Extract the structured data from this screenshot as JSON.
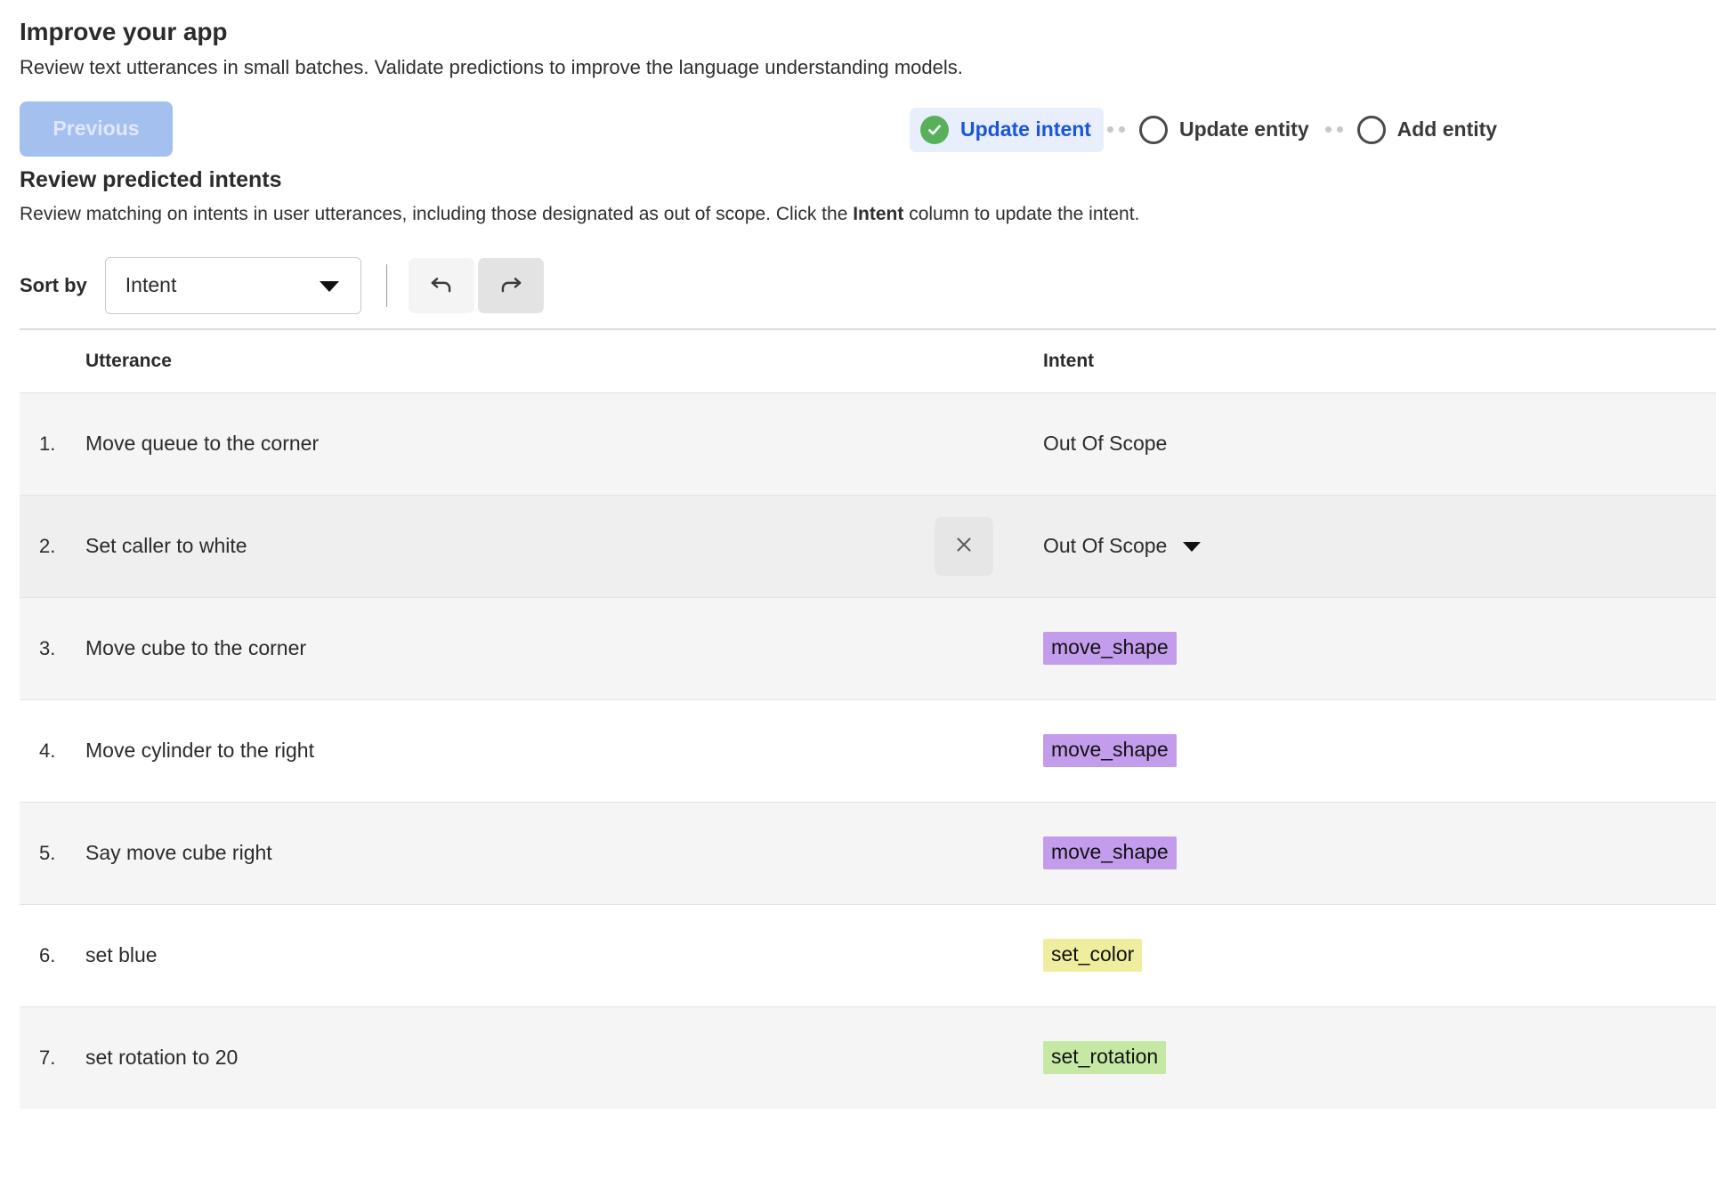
{
  "header": {
    "title": "Improve your app",
    "subtitle": "Review text utterances in small batches. Validate predictions to improve the language understanding models."
  },
  "nav": {
    "previous_label": "Previous"
  },
  "stepper": {
    "active_color": "#1a56d6",
    "active_pill_bg": "#e8eefc",
    "complete_color": "#58b15a",
    "steps": [
      {
        "label": "Update intent",
        "state": "complete",
        "icon": "check-circle-icon"
      },
      {
        "label": "Update entity",
        "state": "pending",
        "icon": "empty-circle-icon"
      },
      {
        "label": "Add entity",
        "state": "pending",
        "icon": "empty-circle-icon"
      }
    ]
  },
  "section": {
    "title": "Review predicted intents",
    "desc_before": "Review matching on intents in user utterances, including those designated as out of scope. Click the ",
    "desc_bold": "Intent",
    "desc_after": " column to update the intent."
  },
  "toolbar": {
    "sort_label": "Sort by",
    "sort_value": "Intent",
    "sort_options": [
      "Intent"
    ],
    "undo_icon": "undo-icon",
    "redo_icon": "redo-icon"
  },
  "table": {
    "columns": {
      "number": "",
      "utterance": "Utterance",
      "intent": "Intent"
    },
    "rows": [
      {
        "num": "1.",
        "utterance": "Move queue to the corner",
        "intent": "Out Of Scope",
        "tag": false,
        "tag_color": "",
        "shaded": true,
        "hover": false,
        "has_clear": false,
        "has_caret": false
      },
      {
        "num": "2.",
        "utterance": "Set caller to white",
        "intent": "Out Of Scope",
        "tag": false,
        "tag_color": "",
        "shaded": false,
        "hover": true,
        "has_clear": true,
        "has_caret": true
      },
      {
        "num": "3.",
        "utterance": "Move cube to the corner",
        "intent": "move_shape",
        "tag": true,
        "tag_color": "#c49cec",
        "shaded": true,
        "hover": false,
        "has_clear": false,
        "has_caret": false
      },
      {
        "num": "4.",
        "utterance": "Move cylinder to the right",
        "intent": "move_shape",
        "tag": true,
        "tag_color": "#c49cec",
        "shaded": false,
        "hover": false,
        "has_clear": false,
        "has_caret": false
      },
      {
        "num": "5.",
        "utterance": "Say move cube right",
        "intent": "move_shape",
        "tag": true,
        "tag_color": "#c49cec",
        "shaded": true,
        "hover": false,
        "has_clear": false,
        "has_caret": false
      },
      {
        "num": "6.",
        "utterance": "set blue",
        "intent": "set_color",
        "tag": true,
        "tag_color": "#eeee9e",
        "shaded": false,
        "hover": false,
        "has_clear": false,
        "has_caret": false
      },
      {
        "num": "7.",
        "utterance": "set rotation to 20",
        "intent": "set_rotation",
        "tag": true,
        "tag_color": "#c5e9a5",
        "shaded": true,
        "hover": false,
        "has_clear": false,
        "has_caret": false
      }
    ]
  }
}
